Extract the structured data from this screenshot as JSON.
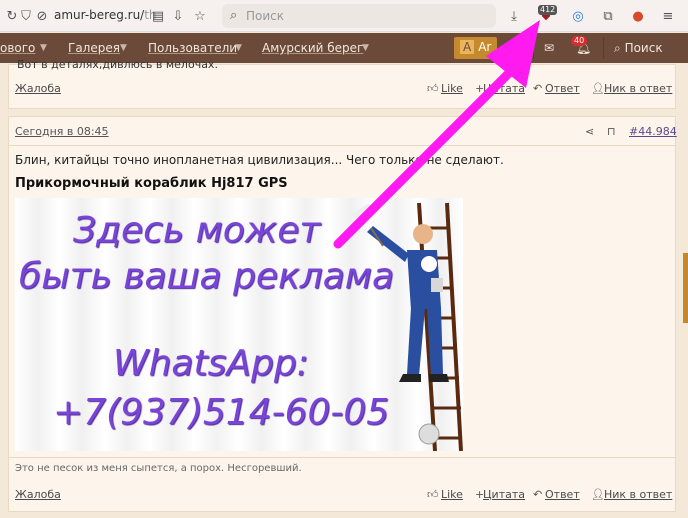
{
  "browser": {
    "url_host": "amur-bereg.ru/",
    "url_rest": "th",
    "search_placeholder": "Поиск",
    "ext_badge": "412"
  },
  "nav": {
    "item_partial": "ового",
    "gallery": "Галерея",
    "users": "Пользователи",
    "amur": "Амурский берег",
    "user_initial": "A",
    "user_name": "Ar",
    "alerts_badge": "40",
    "search": "Поиск"
  },
  "top_post": {
    "clipped_text": "Вот в деталях,дивлюсь в мелочах.",
    "report": "Жалоба",
    "like": "Like",
    "quote": "Цитата",
    "reply": "Ответ",
    "nick": "Ник в ответ"
  },
  "post": {
    "date": "Сегодня в 08:45",
    "number": "#44.984",
    "text": "Блин, китайцы точно инопланетная цивилизация... Чего только не сделают.",
    "title": "Прикормочный кораблик Hj817 GPS",
    "ad": {
      "line1": "Здесь может",
      "line2": "быть ваша реклама",
      "line3": "WhatsApp:",
      "line4": "+7(937)514-60-05"
    },
    "signature": "Это не песок из меня сыпется, а порох. Несгоревший.",
    "report": "Жалоба",
    "like": "Like",
    "quote": "Цитата",
    "reply": "Ответ",
    "nick": "Ник в ответ"
  },
  "colors": {
    "nav_bg": "#6b4a3a",
    "accent": "#c48a2d",
    "page_bg": "#f4e8d8",
    "post_bg": "#fdf5ec",
    "ad_text": "#7a44d8",
    "arrow": "#ff1af0"
  }
}
